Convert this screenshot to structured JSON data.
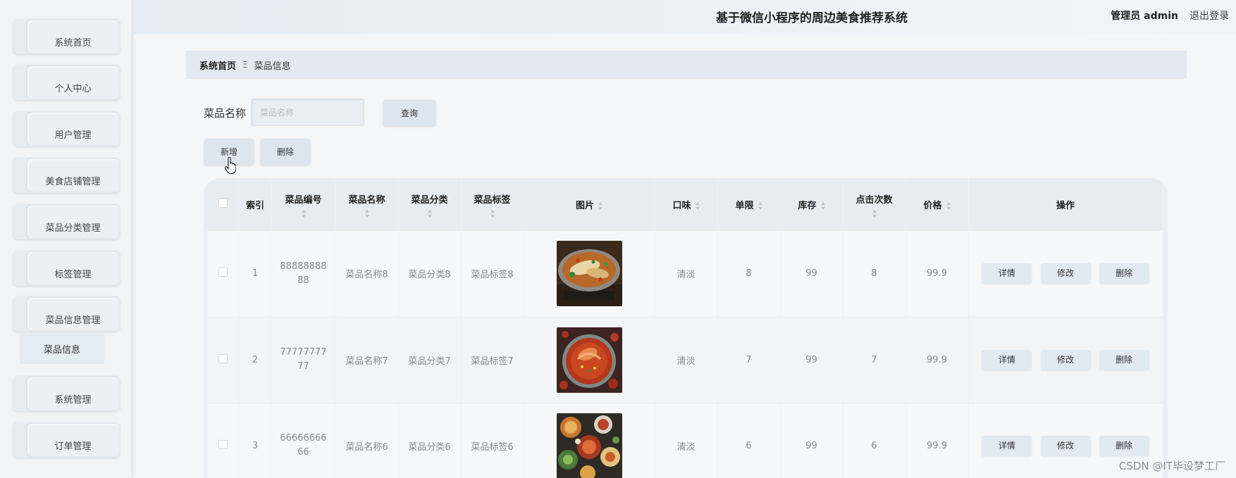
{
  "sidebar": {
    "items": [
      {
        "label": "系统首页"
      },
      {
        "label": "个人中心"
      },
      {
        "label": "用户管理"
      },
      {
        "label": "美食店铺管理"
      },
      {
        "label": "菜品分类管理"
      },
      {
        "label": "标签管理"
      },
      {
        "label": "菜品信息管理"
      },
      {
        "label": "系统管理"
      },
      {
        "label": "订单管理"
      }
    ],
    "submenu_active": "菜品信息"
  },
  "header": {
    "title": "基于微信小程序的周边美食推荐系统",
    "user": "管理员 admin",
    "logout": "退出登录"
  },
  "breadcrumb": {
    "home": "系统首页",
    "separator": "Ξ",
    "current": "菜品信息"
  },
  "search": {
    "label": "菜品名称",
    "placeholder": "菜品名称",
    "query_button": "查询"
  },
  "toolbar": {
    "add_button": "新增",
    "delete_button": "删除"
  },
  "table": {
    "columns": [
      "索引",
      "菜品编号",
      "菜品名称",
      "菜品分类",
      "菜品标签",
      "图片",
      "口味",
      "单限",
      "库存",
      "点击次数",
      "价格",
      "操作"
    ],
    "rows": [
      {
        "index": "1",
        "code": "8888888888",
        "name": "菜品名称8",
        "category": "菜品分类8",
        "tag": "菜品标签8",
        "image": "braised-fish-hotpot",
        "taste": "清淡",
        "limit": "8",
        "stock": "99",
        "clicks": "8",
        "price": "99.9"
      },
      {
        "index": "2",
        "code": "7777777777",
        "name": "菜品名称7",
        "category": "菜品分类7",
        "tag": "菜品标签7",
        "image": "spicy-crayfish-plate",
        "taste": "清淡",
        "limit": "7",
        "stock": "99",
        "clicks": "7",
        "price": "99.9"
      },
      {
        "index": "3",
        "code": "6666666666",
        "name": "菜品名称6",
        "category": "菜品分类6",
        "tag": "菜品标签6",
        "image": "assorted-dishes-spread",
        "taste": "清淡",
        "limit": "6",
        "stock": "99",
        "clicks": "6",
        "price": "99.9"
      }
    ],
    "actions": {
      "detail": "详情",
      "edit": "修改",
      "delete": "删除"
    }
  },
  "watermark": "CSDN @IT毕设梦工厂",
  "colors": {
    "sidebar_bg": "#f2f3f5",
    "menu_bg": "#edf0f3",
    "header_bg": "#e4ebf2",
    "button_bg": "#dde6ef",
    "table_header_bg": "#e6ecf2"
  }
}
